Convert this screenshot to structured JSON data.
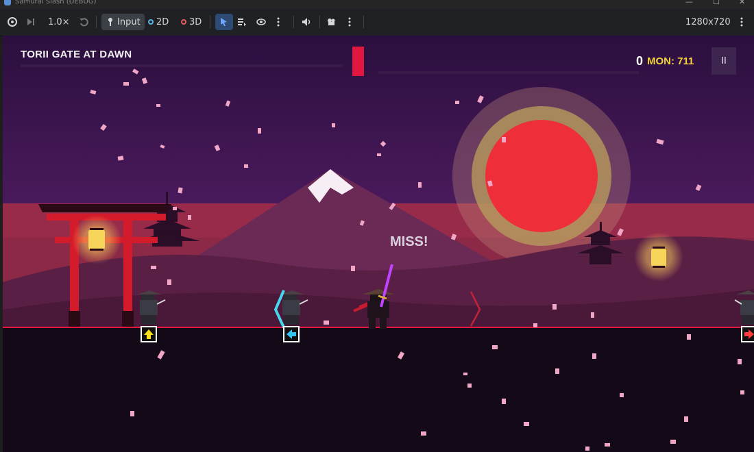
{
  "window": {
    "title": "Samurai Slash (DEBUG)"
  },
  "toolbar": {
    "speed_label": "1.0×",
    "input_label": "Input",
    "mode_2d_label": "2D",
    "mode_3d_label": "3D",
    "resolution_label": "1280x720"
  },
  "hud": {
    "level_title": "TORII GATE AT DAWN",
    "score": "0",
    "mon_label": "MON: 711",
    "pause_label": "II"
  },
  "feedback": {
    "text": "MISS!"
  },
  "prompts": [
    {
      "name": "up-arrow-prompt",
      "direction": "up",
      "color": "#f7e11b"
    },
    {
      "name": "left-arrow-prompt",
      "direction": "left",
      "color": "#35c3f0"
    },
    {
      "name": "right-arrow-prompt",
      "direction": "right",
      "color": "#ff3b3b"
    }
  ],
  "colors": {
    "sky": "#2d1240",
    "sun": "#e8333c",
    "accent": "#e0173f",
    "ground": "#140a17",
    "mon": "#f4d43a"
  }
}
